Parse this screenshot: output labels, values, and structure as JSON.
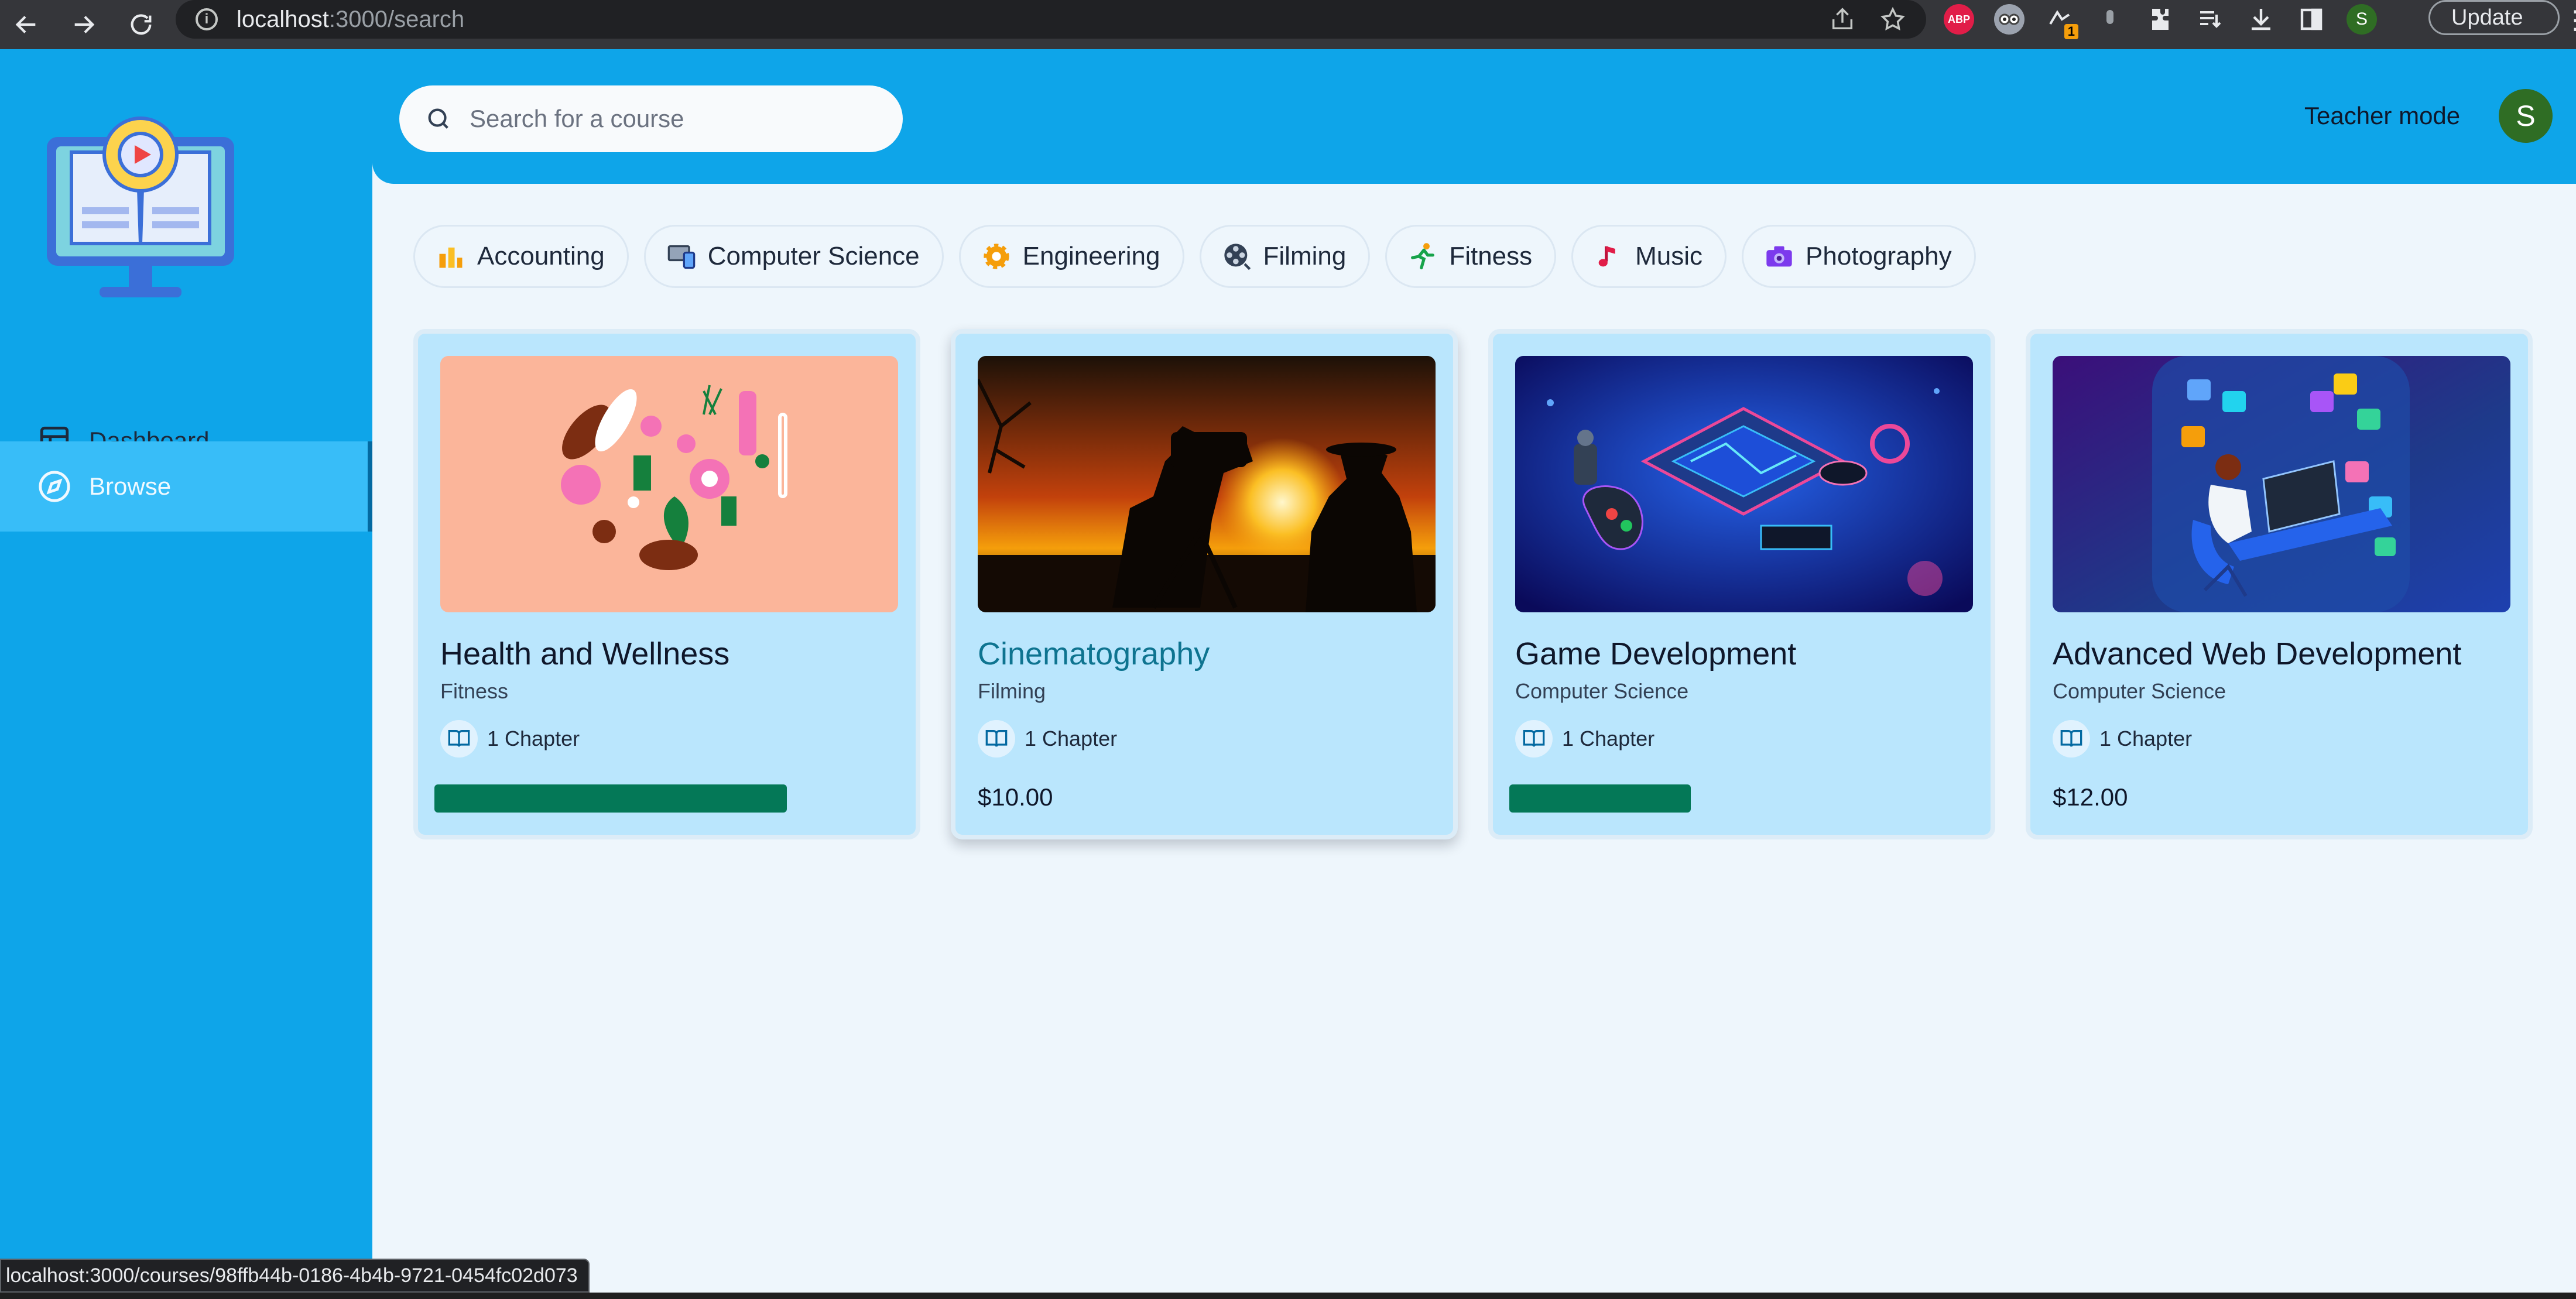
{
  "browser": {
    "url_host": "localhost",
    "url_rest": ":3000/search",
    "update_label": "Update",
    "profile_initial": "S",
    "ext_abp": "ABP",
    "ext_badge": "1"
  },
  "sidebar": {
    "items": [
      {
        "label": "Dashboard",
        "icon": "layout-icon"
      },
      {
        "label": "Browse",
        "icon": "compass-icon"
      }
    ]
  },
  "header": {
    "search_placeholder": "Search for a course",
    "teacher_mode": "Teacher mode",
    "avatar_initial": "S"
  },
  "categories": [
    {
      "label": "Accounting",
      "icon": "bar-chart-icon"
    },
    {
      "label": "Computer Science",
      "icon": "devices-icon"
    },
    {
      "label": "Engineering",
      "icon": "gear-icon"
    },
    {
      "label": "Filming",
      "icon": "film-reel-icon"
    },
    {
      "label": "Fitness",
      "icon": "runner-icon"
    },
    {
      "label": "Music",
      "icon": "music-note-icon"
    },
    {
      "label": "Photography",
      "icon": "camera-icon"
    }
  ],
  "courses": [
    {
      "title": "Health and Wellness",
      "category": "Fitness",
      "chapters": "1 Chapter",
      "progress": 0.7,
      "price": ""
    },
    {
      "title": "Cinematography",
      "category": "Filming",
      "chapters": "1 Chapter",
      "progress": null,
      "price": "$10.00"
    },
    {
      "title": "Game Development",
      "category": "Computer Science",
      "chapters": "1 Chapter",
      "progress": 0.36,
      "price": ""
    },
    {
      "title": "Advanced Web Development",
      "category": "Computer Science",
      "chapters": "1 Chapter",
      "progress": null,
      "price": "$12.00"
    }
  ],
  "status_url": "localhost:3000/courses/98ffb44b-0186-4b4b-9721-0454fc02d073",
  "colors": {
    "primary": "#0ea5e9",
    "card": "#bae6fd",
    "progress": "#047857"
  }
}
